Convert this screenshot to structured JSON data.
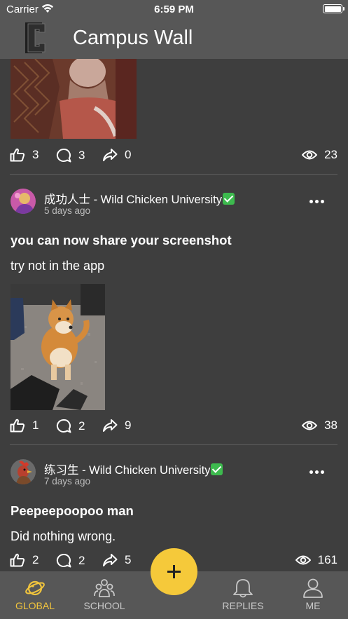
{
  "status_bar": {
    "carrier": "Carrier",
    "time": "6:59 PM"
  },
  "header": {
    "title": "Campus Wall",
    "logo_icon": "campus-c-logo"
  },
  "posts": [
    {
      "stats": {
        "likes": "3",
        "comments": "3",
        "shares": "0",
        "views": "23"
      }
    },
    {
      "author": "成功人士 - Wild Chicken University",
      "time": "5 days ago",
      "title": "you can now share your screenshot",
      "body": "try not in the app",
      "stats": {
        "likes": "1",
        "comments": "2",
        "shares": "9",
        "views": "38"
      }
    },
    {
      "author": "练习生 - Wild Chicken University",
      "time": "7 days ago",
      "title": "Peepeepoopoo man",
      "body": "Did nothing wrong.",
      "stats": {
        "likes": "2",
        "comments": "2",
        "shares": "5",
        "views": "161"
      }
    }
  ],
  "tabs": [
    {
      "label": "GLOBAL",
      "icon": "planet-icon",
      "active": true
    },
    {
      "label": "SCHOOL",
      "icon": "people-icon",
      "active": false
    },
    {
      "label": "REPLIES",
      "icon": "bell-icon",
      "active": false
    },
    {
      "label": "ME",
      "icon": "person-icon",
      "active": false
    }
  ],
  "colors": {
    "accent": "#f5c93a",
    "background": "#3e3e3e",
    "bars": "#575757"
  }
}
